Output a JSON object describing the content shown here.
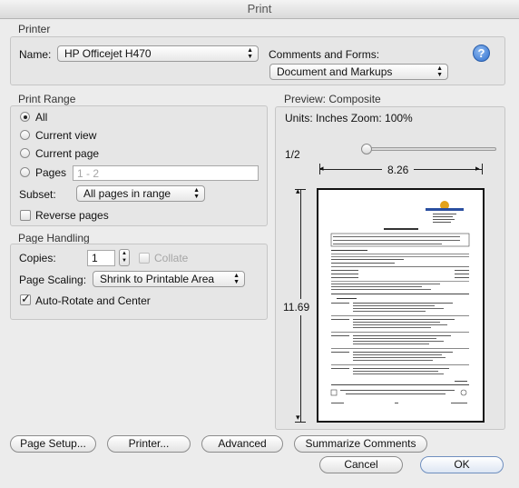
{
  "window": {
    "title": "Print"
  },
  "printer": {
    "section_label": "Printer",
    "name_label": "Name:",
    "name_value": "HP Officejet H470",
    "comments_label": "Comments and Forms:",
    "comments_value": "Document and Markups"
  },
  "print_range": {
    "section_label": "Print Range",
    "options": [
      "All",
      "Current view",
      "Current page",
      "Pages"
    ],
    "selected": "All",
    "pages_value": "1 - 2",
    "subset_label": "Subset:",
    "subset_value": "All pages in range",
    "reverse_label": "Reverse pages",
    "reverse_checked": false
  },
  "page_handling": {
    "section_label": "Page Handling",
    "copies_label": "Copies:",
    "copies_value": "1",
    "collate_label": "Collate",
    "scaling_label": "Page Scaling:",
    "scaling_value": "Shrink to Printable Area",
    "autorotate_label": "Auto-Rotate and Center",
    "autorotate_checked": true
  },
  "preview": {
    "section_label": "Preview: Composite",
    "units_text": "Units: Inches Zoom: 100%",
    "page_indicator": "1/2",
    "width_label": "8.26",
    "height_label": "11.69",
    "slider_position": 0
  },
  "buttons": {
    "page_setup": "Page Setup...",
    "printer": "Printer...",
    "advanced": "Advanced",
    "summarize": "Summarize Comments",
    "cancel": "Cancel",
    "ok": "OK"
  }
}
